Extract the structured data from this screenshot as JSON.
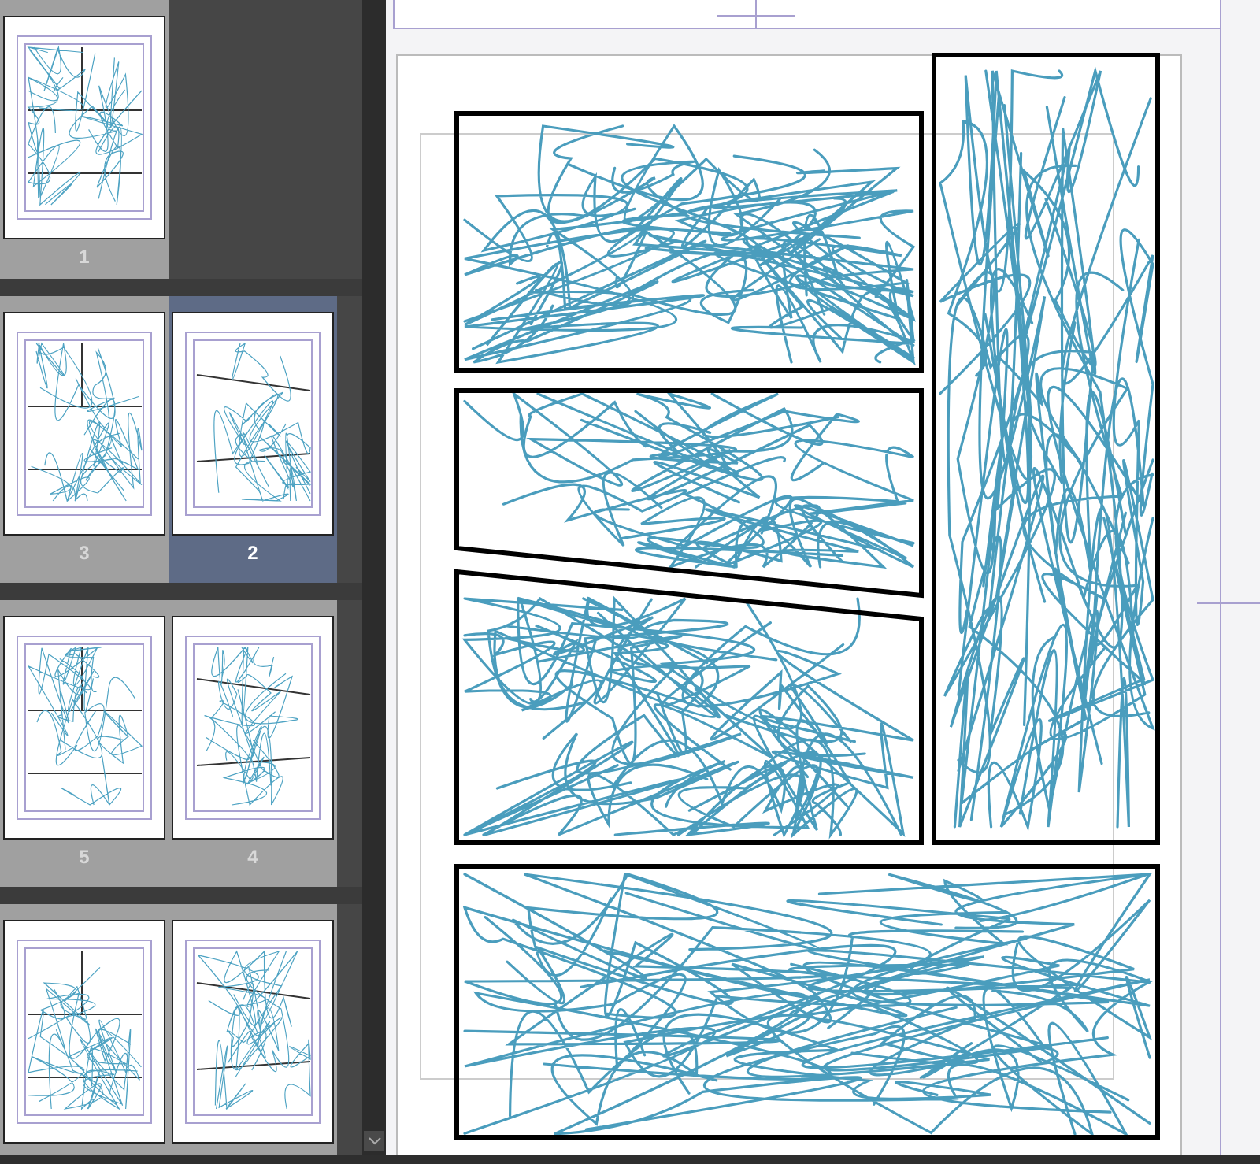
{
  "page_list": {
    "rows": [
      {
        "pages": [
          {
            "label": "1",
            "selected": false
          }
        ]
      },
      {
        "pages": [
          {
            "label": "3",
            "selected": false
          },
          {
            "label": "2",
            "selected": true
          }
        ]
      },
      {
        "pages": [
          {
            "label": "5",
            "selected": false
          },
          {
            "label": "4",
            "selected": false
          }
        ]
      },
      {
        "pages": [
          {
            "selected": false
          },
          {
            "selected": false
          }
        ]
      }
    ]
  }
}
